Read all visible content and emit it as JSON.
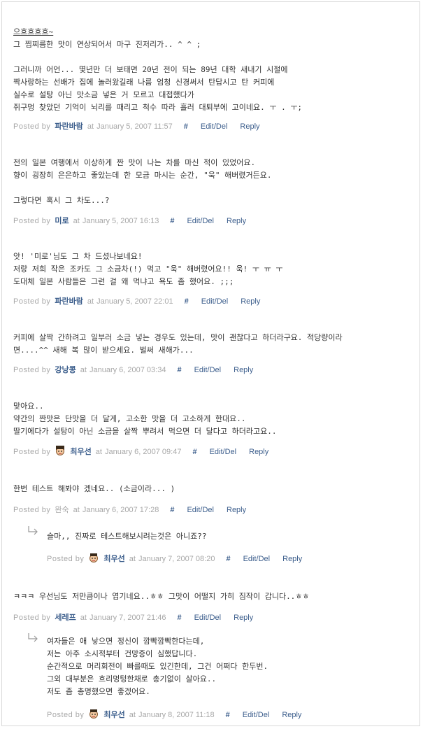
{
  "labels": {
    "posted_by": "Posted by",
    "at": "at",
    "hash": "#",
    "edit": "Edit/Del",
    "reply": "Reply"
  },
  "colors": {
    "link": "#3c5e8c",
    "muted": "#a8a8a8",
    "text": "#333333"
  },
  "comments": [
    {
      "lines": [
        "으흐흐흐흐~",
        "그 찝찌름한 맛이 연상되어서 마구 진저리가.. ^ ^ ;",
        "",
        "그러니까 어언... 몇년만 더 보태면 20년 전이 되는 89년 대학 새내기 시절에",
        "짝사랑하는 선배가 집에 놀러왔길래 나름 엄청 신경써서 탄답시고 탄 커피에",
        "실수로 설탕 아닌 맛소금 넣은 거 모르고 대접했다가",
        "쥐구멍 찾았던 기억이 뇌리를 때리고 척수 따라 흘러 대퇴부에 고이네요. ㅜ . ㅜ;"
      ],
      "author": "파란바람",
      "date": "January 5, 2007 11:57"
    },
    {
      "lines": [
        "전의 일본 여행에서 이상하게 짠 맛이 나는 차를 마신 적이 있었어요.",
        "향이 굉장히 은은하고 좋았는데 한 모금 마시는 순간, \"욱\" 해버렸거든요.",
        "",
        "그렇다면 혹시 그 차도...?"
      ],
      "author": "미로",
      "date": "January 5, 2007 16:13"
    },
    {
      "lines": [
        "앗! '미로'님도 그 차 드셨나보네요!",
        "저랑 저희 작은 조카도 그 소금차(!) 먹고 \"욱\" 해버렸어요!! 욱! ㅜ ㅠ ㅜ",
        "도대체 일본 사람들은 그런 걸 왜 먹냐고 욕도 좀 했어요. ;;;"
      ],
      "author": "파란바람",
      "date": "January 5, 2007 22:01"
    },
    {
      "lines": [
        "커피에 살짝 간하려고 일부러 소금 넣는 경우도 있는데, 맛이 괜찮다고 하더라구요. 적당량이라",
        "면....^^ 새해 복 많이 받으세요. 벌써 새해가..."
      ],
      "author": "강낭콩",
      "date": "January 6, 2007 03:34"
    },
    {
      "lines": [
        "맞아요..",
        "약간의 짠맛은 단맛을 더 달게, 고소한 맛을 더 고소하게 한대요..",
        "딸기에다가 설탕이 아닌 소금을 살짝 뿌려서 먹으면 더 달다고 하더라고요.."
      ],
      "author": "최우선",
      "date": "January 6, 2007 09:47"
    },
    {
      "lines": [
        "한번 테스트 해봐야 겠네요.. (소금이라... )"
      ],
      "author": "완숙",
      "date": "January 6, 2007 17:28"
    },
    {
      "lines": [
        "슬마,, 진짜로 테스트해보시려는것은 아니죠??"
      ],
      "author": "최우선",
      "date": "January 7, 2007 08:20"
    },
    {
      "lines": [
        "ㅋㅋㅋ 우선님도 저만큼이나 엽기네요..ㅎㅎ 그맛이 어떨지 가히 짐작이 갑니다..ㅎㅎ"
      ],
      "author": "세레프",
      "date": "January 7, 2007 21:46"
    },
    {
      "lines": [
        "여자들은 애 낳으면 정신이 깜빡깜빡한다는데,",
        "저는 아주 소시적부터 건망증이 심했답니다.",
        "순간적으로 머리회전이 빠를때도 있긴한데, 그건 어쩌다 한두번.",
        "그외 대부분은 흐리멍텅한채로 총기없이 살아요..",
        "저도 좀 총명했으면 좋겠어요."
      ],
      "author": "최우선",
      "date": "January 8, 2007 11:18"
    }
  ]
}
